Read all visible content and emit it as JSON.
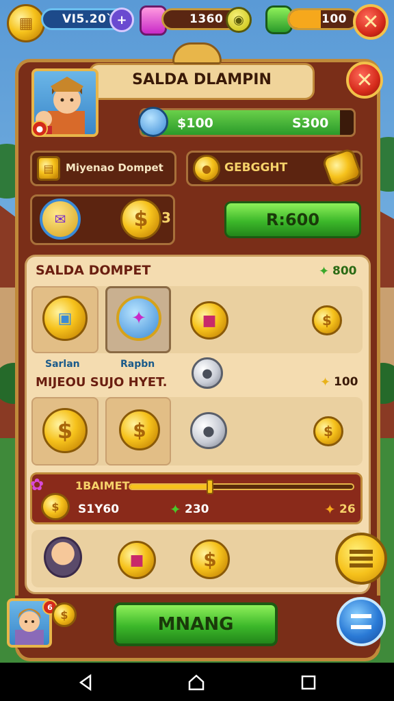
{
  "topbar": {
    "coins_value": "VI5.20`",
    "gems_value": "1360",
    "energy_value": "100",
    "coins_plus_glyph": "+"
  },
  "panel": {
    "title": "SALDA DLAMPIN",
    "balance_left": "$100",
    "balance_right": "S300",
    "wallet_label": "Miyenao Dompet",
    "gold_label": "GEBGGHT",
    "currency_small_glyph": "3",
    "green_button_label": "R:600"
  },
  "section1": {
    "title": "SALDA DOMPET",
    "amount": "800",
    "tile_caption_1": "Sarlan",
    "tile_caption_2": "Rapbn"
  },
  "section2": {
    "title": "MIJEOU SUJO HYET.",
    "amount": "100"
  },
  "progress": {
    "label": "1BAIMET",
    "fill_fraction": 0.36,
    "left_value": "S1Y60",
    "mid_value": "230",
    "right_value": "26"
  },
  "bottom": {
    "main_button_label": "MNANG",
    "profile_badge": "6"
  },
  "colors": {
    "panel": "#7a2e18",
    "gold_trim": "#c08a3a",
    "cream": "#f4dcb0",
    "green": "#3cb82a",
    "red": "#d42a1a"
  }
}
